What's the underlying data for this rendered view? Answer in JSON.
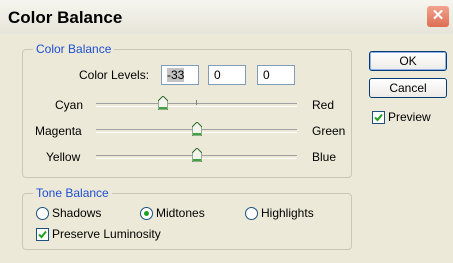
{
  "window": {
    "title": "Color Balance",
    "close_icon": "close-icon"
  },
  "color_balance": {
    "group_label": "Color Balance",
    "levels_label": "Color Levels:",
    "levels": [
      "-33",
      "0",
      "0"
    ],
    "sliders": [
      {
        "left": "Cyan",
        "right": "Red",
        "value": -33
      },
      {
        "left": "Magenta",
        "right": "Green",
        "value": 0
      },
      {
        "left": "Yellow",
        "right": "Blue",
        "value": 0
      }
    ],
    "slider_range": [
      -100,
      100
    ]
  },
  "tone_balance": {
    "group_label": "Tone Balance",
    "options": [
      "Shadows",
      "Midtones",
      "Highlights"
    ],
    "selected": "Midtones",
    "preserve_label": "Preserve Luminosity",
    "preserve_checked": true
  },
  "buttons": {
    "ok": "OK",
    "cancel": "Cancel"
  },
  "preview": {
    "label": "Preview",
    "checked": true
  },
  "colors": {
    "legend": "#1e4fd1",
    "radio_dot": "#21a121",
    "check": "#21a121"
  }
}
